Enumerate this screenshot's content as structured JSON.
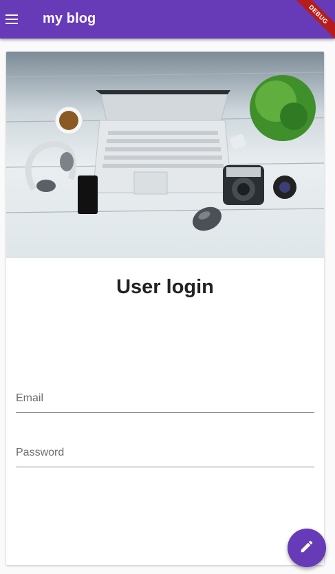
{
  "appbar": {
    "title": "my blog",
    "menu_icon": "menu-icon",
    "debug_banner": "DEBUG"
  },
  "card": {
    "hero_image": "desk-laptop-photo",
    "heading": "User login",
    "email": {
      "value": "",
      "placeholder": "Email"
    },
    "password": {
      "value": "",
      "placeholder": "Password"
    }
  },
  "fab": {
    "icon": "edit-pencil-icon"
  },
  "colors": {
    "primary": "#673ab7",
    "debug": "#b71c1c",
    "background": "#fafafa",
    "card": "#ffffff"
  }
}
